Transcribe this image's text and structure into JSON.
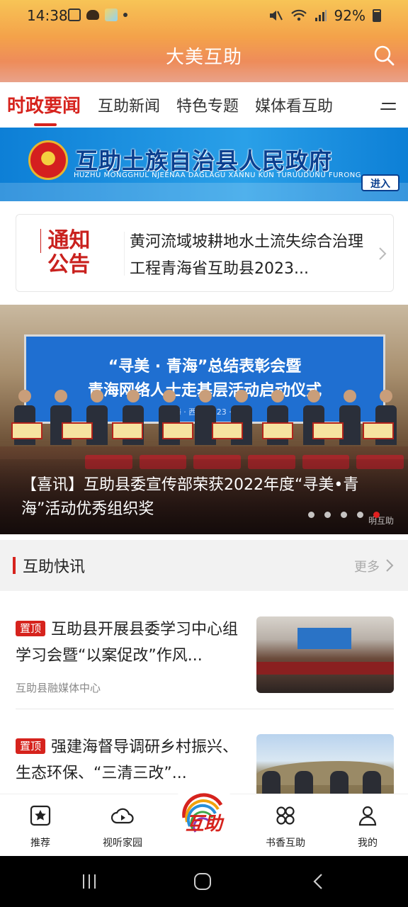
{
  "status_bar": {
    "time": "14:38",
    "battery": "92%"
  },
  "header": {
    "title": "大美互助"
  },
  "tabs": [
    {
      "label": "时政要闻",
      "active": true
    },
    {
      "label": "互助新闻",
      "active": false
    },
    {
      "label": "特色专题",
      "active": false
    },
    {
      "label": "媒体看互助",
      "active": false
    }
  ],
  "gov_banner": {
    "title": "互助土族自治县人民政府",
    "subtitle": "HUZHU MONGGHUL NJEENAA DAGLAGU XANNU KUN TURUUDUNU FURONG",
    "enter_label": "进入"
  },
  "notice": {
    "logo_line1": "通知",
    "logo_line2": "公告",
    "text": "黄河流域坡耕地水土流失综合治理工程青海省互助县2023..."
  },
  "carousel": {
    "stage_line1": "“寻美 · 青海”总结表彰会暨",
    "stage_line2": "青海网络人士走基层活动启动仪式",
    "stage_line3": "青海 · 西宁  2023 · 10",
    "caption": "【喜讯】互助县委宣传部荣获2022年度“寻美•青海”活动优秀组织奖",
    "watermark": "明互助",
    "slide_count": 5,
    "active_index": 4
  },
  "section": {
    "title": "互助快讯",
    "more_label": "更多"
  },
  "news": [
    {
      "pin_label": "置顶",
      "title": "互助县开展县委学习中心组学习会暨“以案促改”作风...",
      "source": "互助县融媒体中心"
    },
    {
      "pin_label": "置顶",
      "title": "强建海督导调研乡村振兴、生态环保、“三清三改”..."
    }
  ],
  "bottom_nav": [
    {
      "label": "推荐",
      "icon": "star-square-icon"
    },
    {
      "label": "视听家园",
      "icon": "play-cloud-icon"
    },
    {
      "label": "互助",
      "icon": "center-logo-icon"
    },
    {
      "label": "书香互助",
      "icon": "grid-clover-icon"
    },
    {
      "label": "我的",
      "icon": "user-icon"
    }
  ],
  "colors": {
    "accent": "#d6231d",
    "banner_blue": "#1f8fe0"
  }
}
